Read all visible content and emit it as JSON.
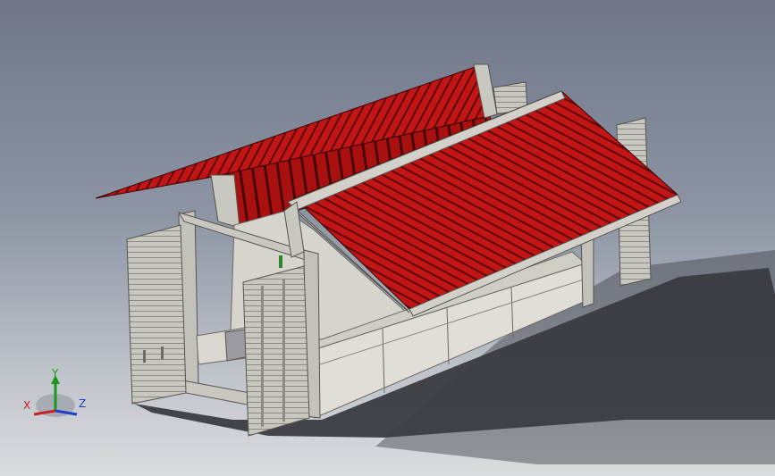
{
  "view": {
    "colors": {
      "background_top": "#6f7688",
      "background_bottom": "#dadcdf",
      "roof": "#c61414",
      "roof_rib": "#5a0606",
      "frame": "#b9b8b0",
      "wall": "#d8d6ce",
      "shadow": "#2a2c31"
    }
  },
  "triad": {
    "x_label": "X",
    "y_label": "Y",
    "z_label": "Z",
    "x_color": "#c81e1e",
    "y_color": "#1a9a1a",
    "z_color": "#1e3ec8"
  }
}
